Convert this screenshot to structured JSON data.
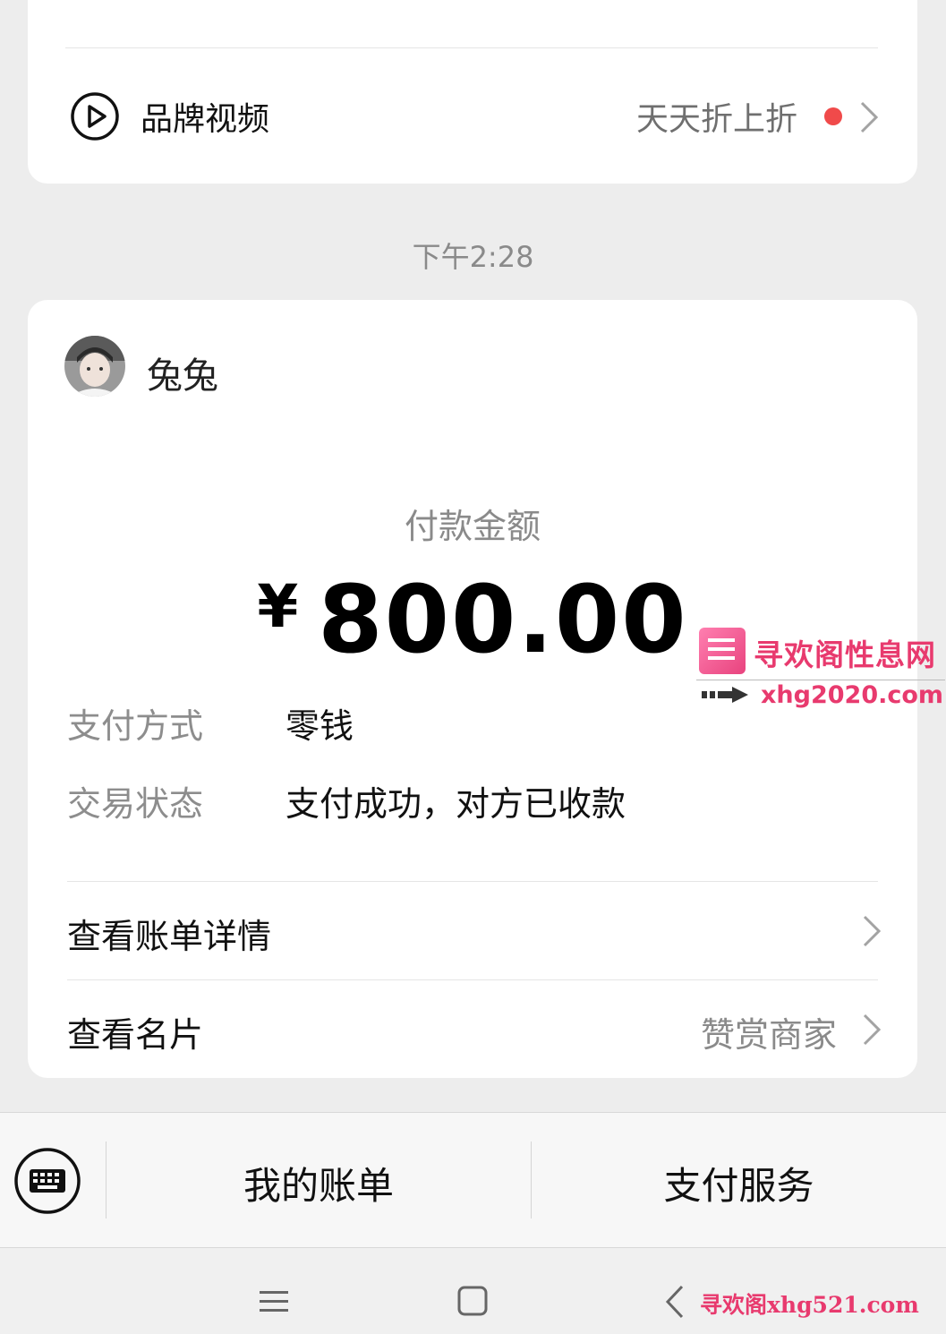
{
  "top_card": {
    "brand_video_label": "品牌视频",
    "brand_video_icon": "play-circle-icon",
    "promo_text": "天天折上折",
    "dot_color": "#f04a4a"
  },
  "timestamp": "下午2:28",
  "payment": {
    "sender_name": "兔兔",
    "amount_label": "付款金额",
    "currency_symbol": "¥",
    "amount": "800.00",
    "method_key": "支付方式",
    "method_value": "零钱",
    "status_key": "交易状态",
    "status_value": "支付成功，对方已收款",
    "bill_details_label": "查看账单详情",
    "card_label": "查看名片",
    "card_side_text": "赞赏商家"
  },
  "watermark": {
    "title": "寻欢阁性息网",
    "url": "xhg2020.com",
    "bottom_text": "寻欢阁xhg521.com",
    "color": "#e83a6e"
  },
  "bottom_bar": {
    "keyboard_icon": "keyboard-icon",
    "my_bills_label": "我的账单",
    "pay_service_label": "支付服务"
  },
  "system_nav": {
    "menu_icon": "menu-icon",
    "home_icon": "home-icon",
    "back_icon": "back-icon"
  }
}
